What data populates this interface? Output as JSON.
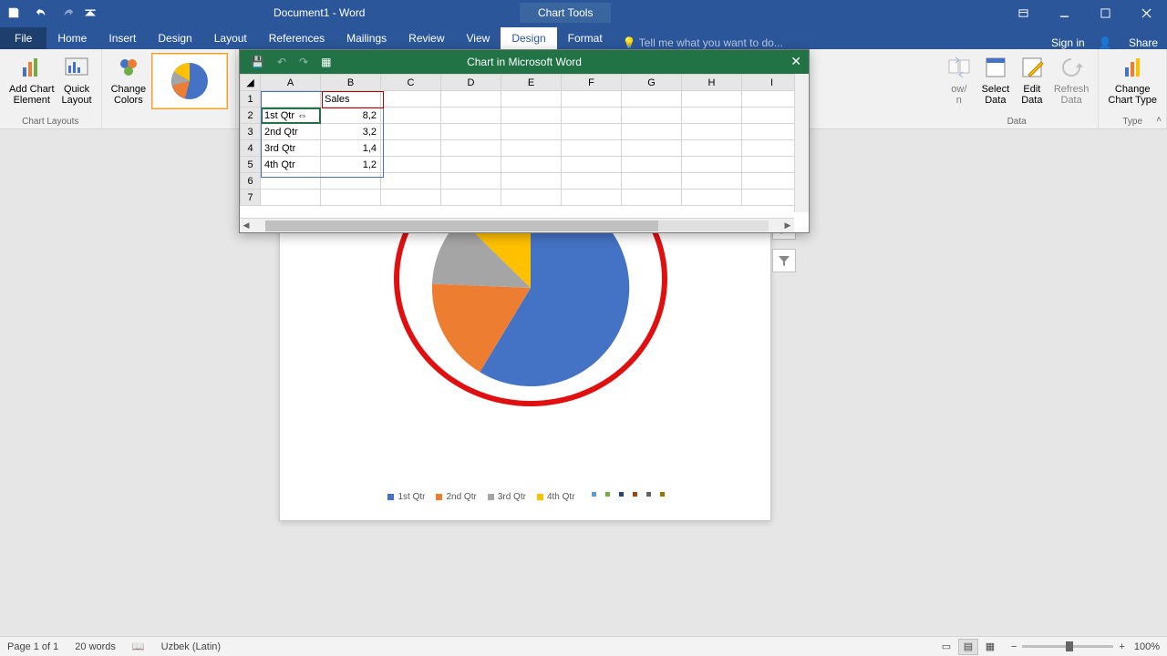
{
  "app": {
    "document_title": "Document1 - Word",
    "chart_tools_label": "Chart Tools"
  },
  "tabs": {
    "file": "File",
    "home": "Home",
    "insert": "Insert",
    "design_main": "Design",
    "layout": "Layout",
    "references": "References",
    "mailings": "Mailings",
    "review": "Review",
    "view": "View",
    "design_chart": "Design",
    "format": "Format",
    "tell_me": "Tell me what you want to do...",
    "sign_in": "Sign in",
    "share": "Share"
  },
  "ribbon": {
    "add_chart_element": "Add Chart\nElement",
    "quick_layout": "Quick\nLayout",
    "change_colors": "Change\nColors",
    "switch_row": "ow/\nn",
    "select_data": "Select\nData",
    "edit_data": "Edit\nData",
    "refresh_data": "Refresh\nData",
    "change_chart_type": "Change\nChart Type",
    "group_layouts": "Chart Layouts",
    "group_data": "Data",
    "group_type": "Type"
  },
  "datasheet": {
    "title": "Chart in Microsoft Word",
    "columns": [
      "A",
      "B",
      "C",
      "D",
      "E",
      "F",
      "G",
      "H",
      "I"
    ],
    "rows": [
      "1",
      "2",
      "3",
      "4",
      "5",
      "6",
      "7"
    ],
    "header_b": "Sales",
    "cells": {
      "a2": "1st Qtr",
      "b2": "8,2",
      "a3": "2nd Qtr",
      "b3": "3,2",
      "a4": "3rd Qtr",
      "b4": "1,4",
      "a5": "4th Qtr",
      "b5": "1,2"
    }
  },
  "chart_data": {
    "type": "pie",
    "title": "Sales",
    "categories": [
      "1st Qtr",
      "2nd Qtr",
      "3rd Qtr",
      "4th Qtr"
    ],
    "values": [
      8.2,
      3.2,
      1.4,
      1.2
    ],
    "colors": [
      "#4472c4",
      "#ed7d31",
      "#a5a5a5",
      "#ffc000"
    ],
    "legend_position": "bottom"
  },
  "legend": {
    "l1": "1st Qtr",
    "l2": "2nd Qtr",
    "l3": "3rd Qtr",
    "l4": "4th Qtr"
  },
  "status": {
    "page": "Page 1 of 1",
    "words": "20 words",
    "lang": "Uzbek (Latin)",
    "zoom": "100%"
  }
}
